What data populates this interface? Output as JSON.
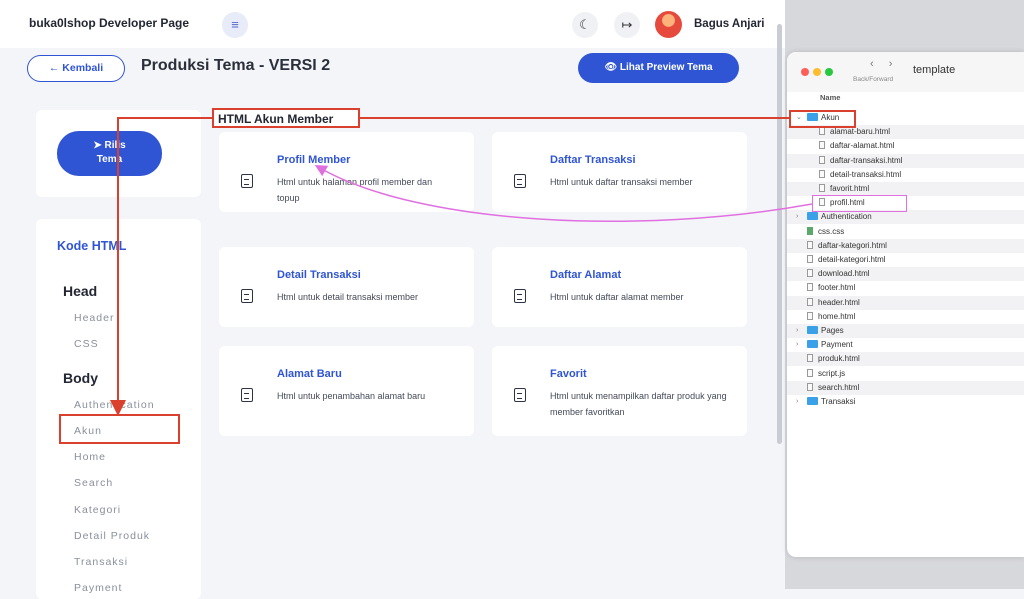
{
  "header": {
    "brand": "buka0lshop Developer Page",
    "menu_icon": "≡",
    "theme_icon": "☾",
    "logout_icon": "↦",
    "username": "Bagus Anjari"
  },
  "toolbar": {
    "back_label": "← Kembali",
    "page_title": "Produksi Tema - VERSI 2",
    "preview_label": "👁 Lihat Preview Tema"
  },
  "sidebar": {
    "release_label": "➤ Rilis\nTema",
    "kode_html_title": "Kode HTML",
    "head_title": "Head",
    "head_items": [
      "Header",
      "CSS"
    ],
    "body_title": "Body",
    "body_items": [
      "Authentication",
      "Akun",
      "Home",
      "Search",
      "Kategori",
      "Detail Produk",
      "Transaksi",
      "Payment"
    ]
  },
  "annotation": {
    "label": "HTML Akun Member"
  },
  "tiles": [
    {
      "title": "Profil Member",
      "desc": "Html untuk halaman profil member dan topup"
    },
    {
      "title": "Daftar Transaksi",
      "desc": "Html untuk daftar transaksi member"
    },
    {
      "title": "Detail Transaksi",
      "desc": "Html untuk detail transaksi member"
    },
    {
      "title": "Daftar Alamat",
      "desc": "Html untuk daftar alamat member"
    },
    {
      "title": "Alamat Baru",
      "desc": "Html untuk penambahan alamat baru"
    },
    {
      "title": "Favorit",
      "desc": "Html untuk menampilkan daftar produk yang member favoritkan"
    }
  ],
  "finder": {
    "nav_arrows": "‹ ›",
    "nav_label": "Back/Forward",
    "window_title": "template",
    "column_header": "Name",
    "items": [
      {
        "name": "Akun",
        "kind": "folder",
        "expanded": true,
        "depth": 0
      },
      {
        "name": "alamat-baru.html",
        "kind": "file",
        "depth": 1
      },
      {
        "name": "daftar-alamat.html",
        "kind": "file",
        "depth": 1
      },
      {
        "name": "daftar-transaksi.html",
        "kind": "file",
        "depth": 1
      },
      {
        "name": "detail-transaksi.html",
        "kind": "file",
        "depth": 1
      },
      {
        "name": "favorit.html",
        "kind": "file",
        "depth": 1
      },
      {
        "name": "profil.html",
        "kind": "file",
        "depth": 1
      },
      {
        "name": "Authentication",
        "kind": "folder",
        "expanded": false,
        "depth": 0
      },
      {
        "name": "css.css",
        "kind": "css",
        "depth": 0
      },
      {
        "name": "daftar-kategori.html",
        "kind": "file",
        "depth": 0
      },
      {
        "name": "detail-kategori.html",
        "kind": "file",
        "depth": 0
      },
      {
        "name": "download.html",
        "kind": "file",
        "depth": 0
      },
      {
        "name": "footer.html",
        "kind": "file",
        "depth": 0
      },
      {
        "name": "header.html",
        "kind": "file",
        "depth": 0
      },
      {
        "name": "home.html",
        "kind": "file",
        "depth": 0
      },
      {
        "name": "Pages",
        "kind": "folder",
        "expanded": false,
        "depth": 0
      },
      {
        "name": "Payment",
        "kind": "folder",
        "expanded": false,
        "depth": 0
      },
      {
        "name": "produk.html",
        "kind": "file",
        "depth": 0
      },
      {
        "name": "script.js",
        "kind": "file",
        "depth": 0
      },
      {
        "name": "search.html",
        "kind": "file",
        "depth": 0
      },
      {
        "name": "Transaksi",
        "kind": "folder",
        "expanded": false,
        "depth": 0
      }
    ]
  },
  "colors": {
    "accent": "#2f55d4",
    "annotation_red": "#d9412e",
    "annotation_pink": "#e070e0"
  }
}
